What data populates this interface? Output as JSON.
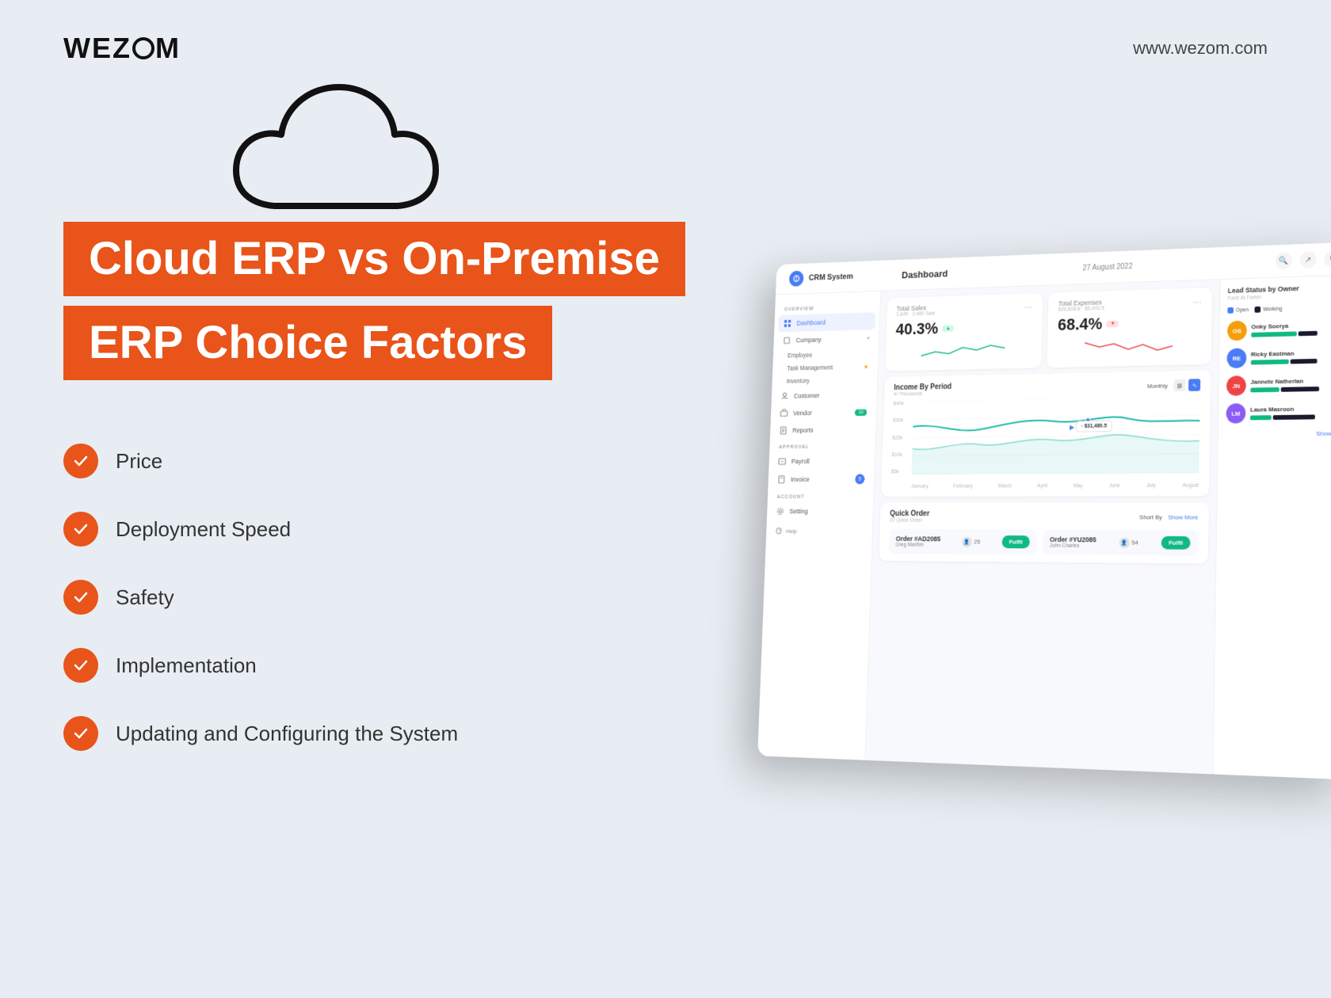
{
  "header": {
    "logo": "WEZOM",
    "website": "www.wezom.com"
  },
  "hero": {
    "title_line1": "Cloud ERP vs On-Premise",
    "title_line2": "ERP Choice Factors"
  },
  "checklist": {
    "items": [
      {
        "label": "Price"
      },
      {
        "label": "Deployment Speed"
      },
      {
        "label": "Safety"
      },
      {
        "label": "Implementation"
      },
      {
        "label": "Updating and Configuring the System"
      }
    ]
  },
  "dashboard": {
    "app_name": "CRM System",
    "page_title": "Dashboard",
    "date": "27 August 2022",
    "sidebar": {
      "overview_label": "OVERVIEW",
      "items": [
        {
          "label": "Dashboard",
          "active": true
        },
        {
          "label": "Company",
          "has_chevron": true
        },
        {
          "label": "Employee"
        },
        {
          "label": "Task Management",
          "has_star": true
        },
        {
          "label": "Inventory"
        },
        {
          "label": "Customer"
        },
        {
          "label": "Vendor",
          "badge": "10"
        },
        {
          "label": "Reports"
        }
      ],
      "approval_label": "APPROVAL",
      "approval_items": [
        {
          "label": "Payroll"
        },
        {
          "label": "Invoice",
          "dot_badge": "5"
        }
      ],
      "account_label": "ACCOUNT",
      "account_items": [
        {
          "label": "Setting"
        }
      ],
      "help_label": "Help"
    },
    "kpi": [
      {
        "label": "Total Sales",
        "sublabel": "1,645 · 2,480 Sale",
        "value": "40.3%",
        "trend": "up"
      },
      {
        "label": "Total Expenses",
        "sublabel": "$20,608.8 · $8,400.5",
        "value": "68.4%",
        "trend": "down"
      }
    ],
    "income_chart": {
      "title": "Income By Period",
      "subtitle": "In Thousands",
      "period": "Monthly",
      "y_labels": [
        "$40k",
        "$30k",
        "$20k",
        "$10k",
        "$5k"
      ],
      "x_labels": [
        "January",
        "February",
        "March",
        "April",
        "May",
        "June",
        "July",
        "August"
      ],
      "tooltip_value": "· $31,480.5"
    },
    "quick_order": {
      "title": "Quick Order",
      "subtitle": "20 Quick Order",
      "sort_label": "Short By",
      "show_more": "Show More",
      "orders": [
        {
          "id": "Order #AD2085",
          "name": "Greg Marthin",
          "count": "25",
          "status": "Fulfil"
        },
        {
          "id": "Order #YU2085",
          "name": "John Charles",
          "count": "54",
          "status": "Fulfil"
        }
      ]
    },
    "lead_status": {
      "title": "Lead Status by Owner",
      "subtitle": "Fariz Al Farish",
      "legend": [
        {
          "label": "Open",
          "color": "#4A7CF6"
        },
        {
          "label": "Working",
          "color": "#1a1a2e"
        }
      ],
      "persons": [
        {
          "name": "Onky Soerya",
          "initials": "OS",
          "bg": "#F59E0B",
          "bar1_w": 60,
          "bar1_c": "#10B981",
          "bar2_w": 30,
          "bar2_c": "#1a1a2e"
        },
        {
          "name": "Ricky Eastman",
          "initials": "RE",
          "bg": "#4A7CF6",
          "bar1_w": 50,
          "bar1_c": "#10B981",
          "bar2_w": 40,
          "bar2_c": "#1a1a2e"
        },
        {
          "name": "Jannete Natherlan",
          "initials": "JN",
          "bg": "#EF4444",
          "bar1_w": 40,
          "bar1_c": "#10B981",
          "bar2_w": 55,
          "bar2_c": "#1a1a2e"
        },
        {
          "name": "Laura Masroon",
          "initials": "LM",
          "bg": "#8B5CF6",
          "bar1_w": 30,
          "bar1_c": "#10B981",
          "bar2_w": 60,
          "bar2_c": "#1a1a2e"
        }
      ],
      "show_more": "Show More"
    }
  }
}
